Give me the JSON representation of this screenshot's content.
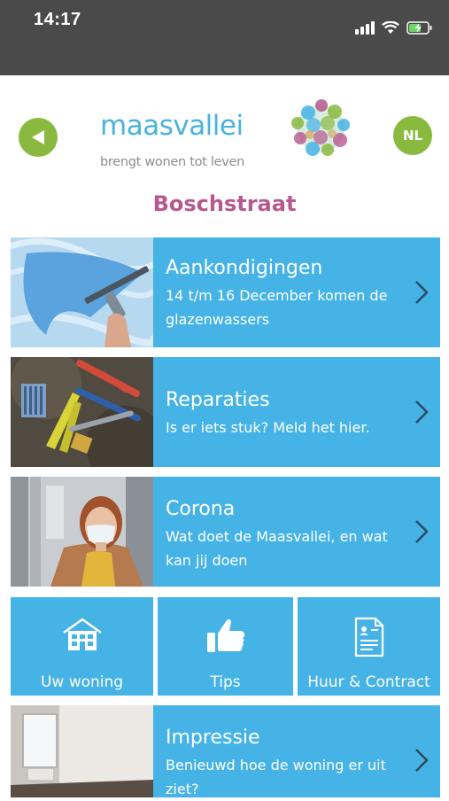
{
  "status_bar": {
    "time": "14:17"
  },
  "header": {
    "logo_name": "maasvallei",
    "logo_tagline": "brengt wonen tot leven",
    "language": "NL",
    "page_title": "Boschstraat"
  },
  "cards": [
    {
      "title": "Aankondigingen",
      "desc": "14 t/m 16 December komen de glazenwassers"
    },
    {
      "title": "Reparaties",
      "desc": "Is er iets stuk? Meld het hier."
    },
    {
      "title": "Corona",
      "desc": "Wat doet de Maasvallei, en wat kan jij doen"
    },
    {
      "title": "Impressie",
      "desc": "Benieuwd hoe de woning er uit ziet?"
    }
  ],
  "tiles": [
    {
      "label": "Uw woning",
      "icon": "house-icon"
    },
    {
      "label": "Tips",
      "icon": "thumbs-up-icon"
    },
    {
      "label": "Huur & Contract",
      "icon": "document-icon"
    }
  ],
  "colors": {
    "accent_green": "#8ab93f",
    "tile_blue": "#46b3e6",
    "title_pink": "#b7588e",
    "logo_blue": "#49b3dd",
    "status_bar": "#4a4a4a"
  }
}
